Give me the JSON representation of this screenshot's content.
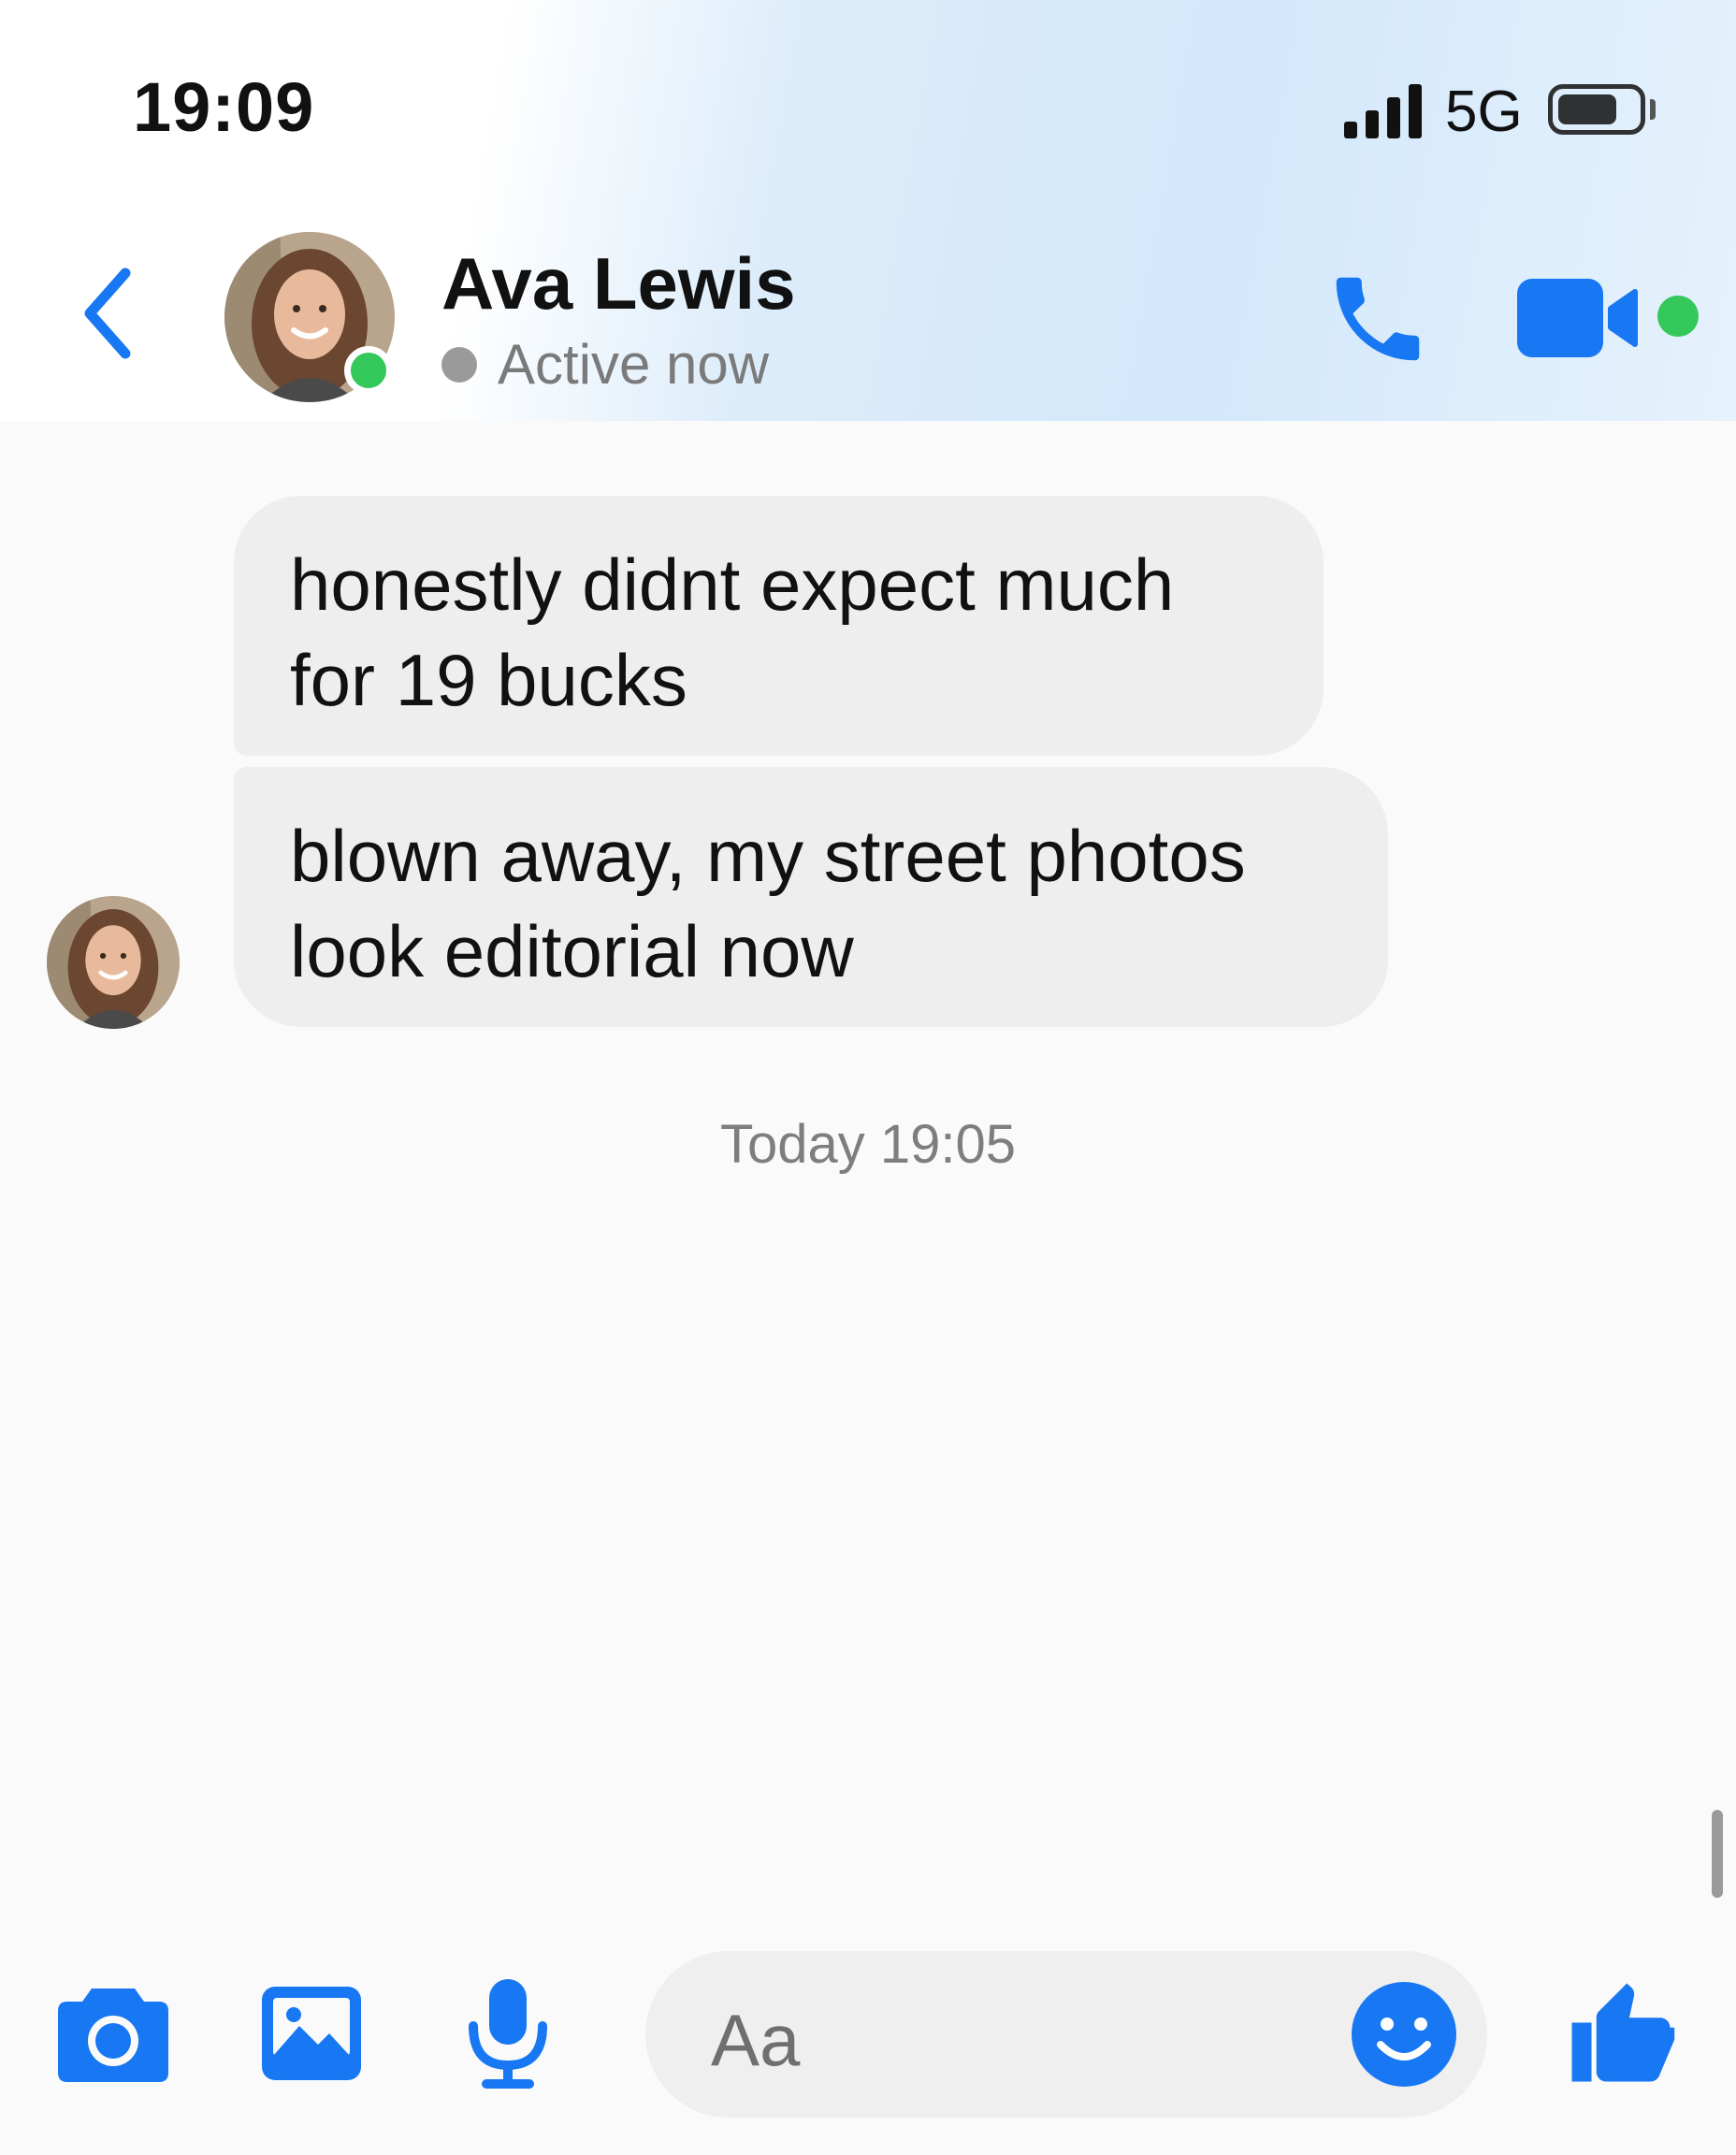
{
  "status_bar": {
    "time": "19:09",
    "network": "5G",
    "battery_fraction": 0.7
  },
  "header": {
    "back_icon": "chevron-left-icon",
    "contact_name": "Ava Lewis",
    "presence": "Active now",
    "actions": [
      "phone-icon",
      "video-camera-icon"
    ]
  },
  "messages": [
    {
      "sender": "Ava Lewis",
      "text": "honestly didnt expect much for 19 bucks"
    },
    {
      "sender": "Ava Lewis",
      "text": "blown away, my street photos look editorial now"
    }
  ],
  "timestamp": "Today 19:05",
  "composer": {
    "placeholder": "Aa",
    "tools": [
      "camera-icon",
      "image-icon",
      "microphone-icon"
    ],
    "emoji_icon": "smiley-icon",
    "send_icon": "thumbs-up-icon"
  },
  "colors": {
    "accent": "#1877f2",
    "online": "#34c759",
    "bubble": "#eeeeee"
  }
}
